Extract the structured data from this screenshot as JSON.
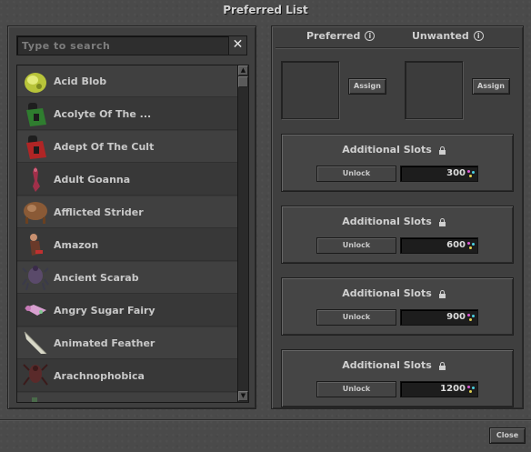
{
  "window": {
    "title": "Preferred List"
  },
  "search": {
    "placeholder": "Type to search",
    "value": "",
    "clear_label": "✕"
  },
  "creatures": [
    {
      "name": "Acid Blob",
      "icon": "acid-blob-icon",
      "color": "#b8c43a"
    },
    {
      "name": "Acolyte Of The ...",
      "icon": "acolyte-icon",
      "color": "#2f7d2f"
    },
    {
      "name": "Adept Of The Cult",
      "icon": "adept-icon",
      "color": "#b02525"
    },
    {
      "name": "Adult Goanna",
      "icon": "goanna-icon",
      "color": "#a0304a"
    },
    {
      "name": "Afflicted Strider",
      "icon": "strider-icon",
      "color": "#8a5a36"
    },
    {
      "name": "Amazon",
      "icon": "amazon-icon",
      "color": "#6a3a2a"
    },
    {
      "name": "Ancient Scarab",
      "icon": "scarab-icon",
      "color": "#5a4a6a"
    },
    {
      "name": "Angry Sugar Fairy",
      "icon": "sugar-fairy-icon",
      "color": "#c87ab8"
    },
    {
      "name": "Animated Feather",
      "icon": "feather-icon",
      "color": "#d8d8c8"
    },
    {
      "name": "Arachnophobica",
      "icon": "arachnophobica-icon",
      "color": "#5a2a2a"
    }
  ],
  "preferences": {
    "preferred_label": "Preferred",
    "unwanted_label": "Unwanted",
    "assign_label": "Assign",
    "info_glyph": "i"
  },
  "slots": [
    {
      "title": "Additional Slots",
      "unlock_label": "Unlock",
      "price": "300"
    },
    {
      "title": "Additional Slots",
      "unlock_label": "Unlock",
      "price": "600"
    },
    {
      "title": "Additional Slots",
      "unlock_label": "Unlock",
      "price": "900"
    },
    {
      "title": "Additional Slots",
      "unlock_label": "Unlock",
      "price": "1200"
    }
  ],
  "footer": {
    "close_label": "Close"
  },
  "colors": {
    "coin_pink": "#e05ad8",
    "coin_cyan": "#4ad0e0",
    "coin_yellow": "#e0d050"
  }
}
